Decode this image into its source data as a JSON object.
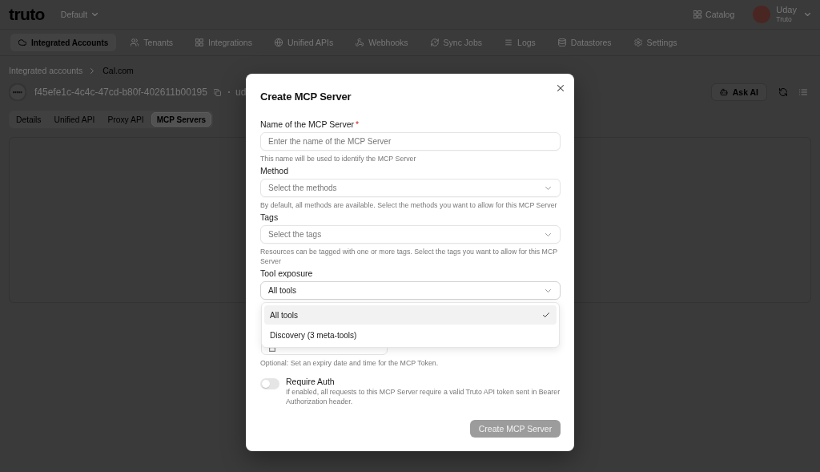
{
  "header": {
    "logo": "truto",
    "workspace": "Default",
    "catalog": "Catalog",
    "user": {
      "name": "Uday",
      "org": "Truto"
    }
  },
  "nav": [
    {
      "label": "Integrated Accounts",
      "selected": true
    },
    {
      "label": "Tenants",
      "selected": false
    },
    {
      "label": "Integrations",
      "selected": false
    },
    {
      "label": "Unified APIs",
      "selected": false
    },
    {
      "label": "Webhooks",
      "selected": false
    },
    {
      "label": "Sync Jobs",
      "selected": false
    },
    {
      "label": "Logs",
      "selected": false
    },
    {
      "label": "Datastores",
      "selected": false
    },
    {
      "label": "Settings",
      "selected": false
    }
  ],
  "breadcrumb": [
    "Integrated accounts",
    "Cal.com"
  ],
  "account": {
    "id": "f45efe1c-4c4c-47cd-b80f-402611b00195",
    "truncated_text": "ud"
  },
  "toolbar": {
    "ask_ai": "Ask AI"
  },
  "sub_tabs": [
    {
      "label": "Details",
      "selected": false
    },
    {
      "label": "Unified API",
      "selected": false
    },
    {
      "label": "Proxy API",
      "selected": false
    },
    {
      "label": "MCP Servers",
      "selected": true
    }
  ],
  "dialog": {
    "title": "Create MCP Server",
    "fields": [
      {
        "kind": "input",
        "label": "Name of the MCP Server",
        "required_mark": "*",
        "placeholder": "Enter the name of the MCP Server",
        "hint": "This name will be used to identify the MCP Server"
      },
      {
        "kind": "select",
        "label": "Method",
        "placeholder": "Select the methods",
        "hint": "By default, all methods are available. Select the methods you want to allow for this MCP Server"
      },
      {
        "kind": "select",
        "label": "Tags",
        "placeholder": "Select the tags",
        "hint": "Resources can be tagged with one or more tags. Select the tags you want to allow for this MCP Server"
      },
      {
        "kind": "select",
        "label": "Tool exposure",
        "value": "All tools",
        "expanded": true,
        "options": [
          {
            "label": "All tools",
            "selected": true
          },
          {
            "label": "Discovery (3 meta-tools)",
            "selected": false
          }
        ]
      },
      {
        "kind": "date",
        "hint": "Optional: Set an expiry date and time for the MCP Token."
      },
      {
        "kind": "switch",
        "label": "Require Auth",
        "on": false,
        "hint": "If enabled, all requests to this MCP Server require a valid Truto API token sent in Bearer Authorization header."
      }
    ],
    "submit": {
      "label": "Create MCP Server",
      "disabled": true
    }
  }
}
